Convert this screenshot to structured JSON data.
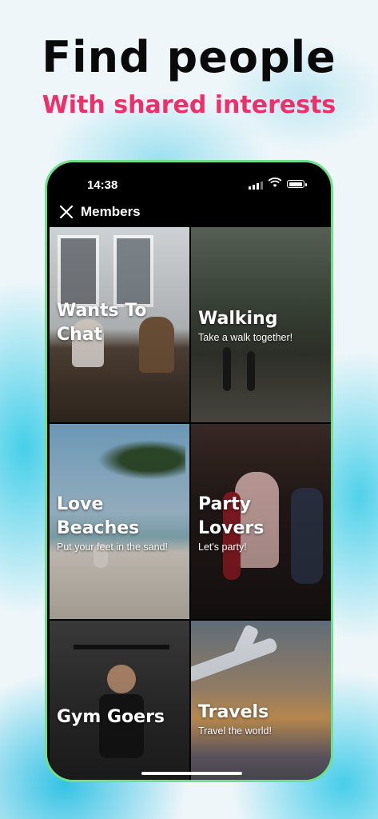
{
  "headline": "Find people",
  "subheadline": "With shared interests",
  "colors": {
    "accent_pink": "#ef2f6a",
    "phone_frame": "#6ee08a"
  },
  "status_bar": {
    "time": "14:38",
    "icons": [
      "signal-icon",
      "wifi-icon",
      "battery-icon"
    ]
  },
  "nav": {
    "close_icon": "close-icon",
    "title": "Members"
  },
  "tiles": [
    {
      "title_line1": "Wants To",
      "title_line2": "Chat",
      "description": ""
    },
    {
      "title_line1": "Walking",
      "title_line2": "",
      "description": "Take a walk together!"
    },
    {
      "title_line1": "Love",
      "title_line2": "Beaches",
      "description": "Put your feet in the sand!"
    },
    {
      "title_line1": "Party",
      "title_line2": "Lovers",
      "description": "Let's party!"
    },
    {
      "title_line1": "Gym Goers",
      "title_line2": "",
      "description": ""
    },
    {
      "title_line1": "Travels",
      "title_line2": "",
      "description": "Travel the world!"
    }
  ]
}
